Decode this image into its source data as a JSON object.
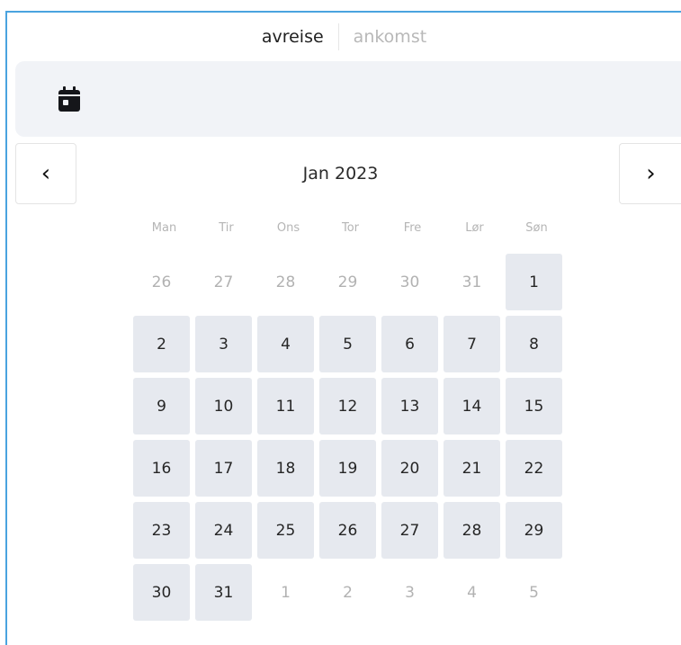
{
  "tabs": {
    "departure": "avreise",
    "arrival": "ankomst"
  },
  "date_field": {
    "icon": "calendar-icon"
  },
  "calendar": {
    "prev_icon": "‹",
    "next_icon": "›",
    "month_title": "Jan 2023",
    "weekdays": [
      "Man",
      "Tir",
      "Ons",
      "Tor",
      "Fre",
      "Lør",
      "Søn"
    ],
    "days": [
      {
        "label": "26",
        "in_month": false
      },
      {
        "label": "27",
        "in_month": false
      },
      {
        "label": "28",
        "in_month": false
      },
      {
        "label": "29",
        "in_month": false
      },
      {
        "label": "30",
        "in_month": false
      },
      {
        "label": "31",
        "in_month": false
      },
      {
        "label": "1",
        "in_month": true
      },
      {
        "label": "2",
        "in_month": true
      },
      {
        "label": "3",
        "in_month": true
      },
      {
        "label": "4",
        "in_month": true
      },
      {
        "label": "5",
        "in_month": true
      },
      {
        "label": "6",
        "in_month": true
      },
      {
        "label": "7",
        "in_month": true
      },
      {
        "label": "8",
        "in_month": true
      },
      {
        "label": "9",
        "in_month": true
      },
      {
        "label": "10",
        "in_month": true
      },
      {
        "label": "11",
        "in_month": true
      },
      {
        "label": "12",
        "in_month": true
      },
      {
        "label": "13",
        "in_month": true
      },
      {
        "label": "14",
        "in_month": true
      },
      {
        "label": "15",
        "in_month": true
      },
      {
        "label": "16",
        "in_month": true
      },
      {
        "label": "17",
        "in_month": true
      },
      {
        "label": "18",
        "in_month": true
      },
      {
        "label": "19",
        "in_month": true
      },
      {
        "label": "20",
        "in_month": true
      },
      {
        "label": "21",
        "in_month": true
      },
      {
        "label": "22",
        "in_month": true
      },
      {
        "label": "23",
        "in_month": true
      },
      {
        "label": "24",
        "in_month": true
      },
      {
        "label": "25",
        "in_month": true
      },
      {
        "label": "26",
        "in_month": true
      },
      {
        "label": "27",
        "in_month": true
      },
      {
        "label": "28",
        "in_month": true
      },
      {
        "label": "29",
        "in_month": true
      },
      {
        "label": "30",
        "in_month": true
      },
      {
        "label": "31",
        "in_month": true
      },
      {
        "label": "1",
        "in_month": false
      },
      {
        "label": "2",
        "in_month": false
      },
      {
        "label": "3",
        "in_month": false
      },
      {
        "label": "4",
        "in_month": false
      },
      {
        "label": "5",
        "in_month": false
      }
    ]
  },
  "colors": {
    "accent_border": "#4aa3df",
    "day_fill": "#e6e9ef",
    "field_bg": "#f1f3f7"
  }
}
